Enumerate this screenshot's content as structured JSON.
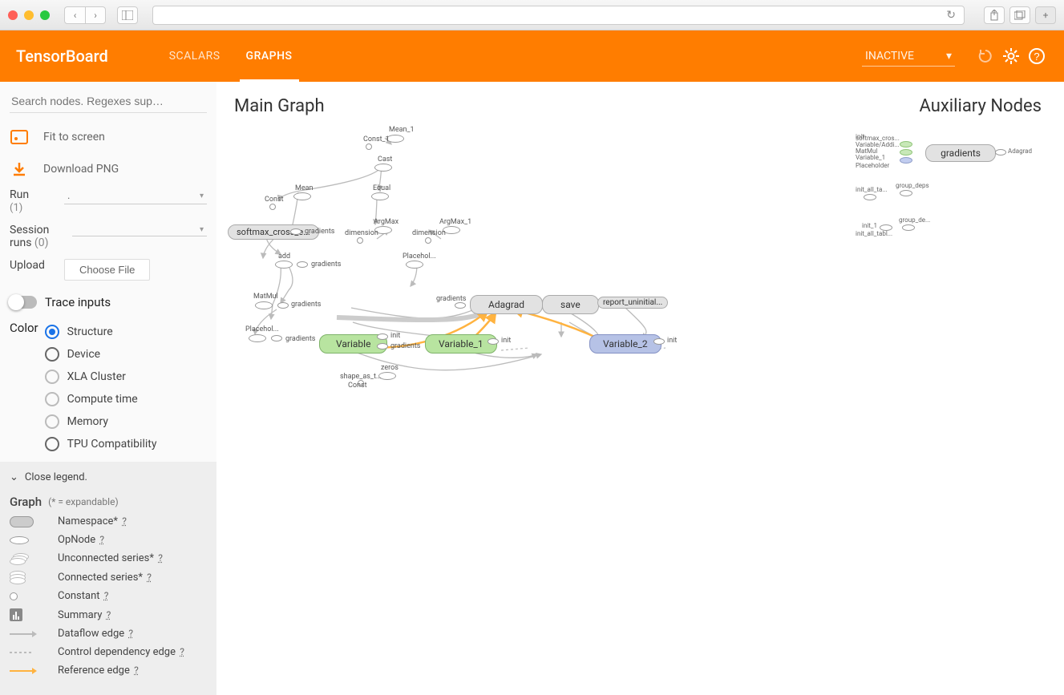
{
  "browser": {
    "reload_icon": "↻"
  },
  "header": {
    "logo": "TensorBoard",
    "tabs": [
      "SCALARS",
      "GRAPHS"
    ],
    "active_tab": 1,
    "dropdown": "INACTIVE"
  },
  "sidebar": {
    "search_placeholder": "Search nodes. Regexes sup…",
    "fit": "Fit to screen",
    "download": "Download PNG",
    "run_label": "Run",
    "run_count": "(1)",
    "run_value": ".",
    "session_label": "Session runs",
    "session_count": "(0)",
    "upload_label": "Upload",
    "choose_file": "Choose File",
    "trace": "Trace inputs",
    "color_label": "Color",
    "color_options": [
      "Structure",
      "Device",
      "XLA Cluster",
      "Compute time",
      "Memory",
      "TPU Compatibility"
    ]
  },
  "legend": {
    "close": "Close legend.",
    "title": "Graph",
    "hint": "(* = expandable)",
    "items": [
      "Namespace*",
      "OpNode",
      "Unconnected series*",
      "Connected series*",
      "Constant",
      "Summary",
      "Dataflow edge",
      "Control dependency edge",
      "Reference edge"
    ]
  },
  "canvas": {
    "main_title": "Main Graph",
    "aux_title": "Auxiliary Nodes",
    "nodes": {
      "softmax": "softmax_cross_e...",
      "adagrad": "Adagrad",
      "save": "save",
      "report": "report_uninitial...",
      "variable": "Variable",
      "variable1": "Variable_1",
      "variable2": "Variable_2",
      "gradients": "gradients",
      "mean1": "Mean_1",
      "const1": "Const_1",
      "cast": "Cast",
      "mean": "Mean",
      "const": "Const",
      "equal": "Equal",
      "argmax": "ArgMax",
      "argmax1": "ArgMax_1",
      "dimension": "dimension",
      "add": "add",
      "matmul": "MatMul",
      "placehol": "Placehol...",
      "zeros": "zeros",
      "shape_as": "shape_as_t...",
      "init": "init",
      "group_deps": "group_deps",
      "group_de": "group_de...",
      "init1": "init_1",
      "init_all_ta": "init_all_ta...",
      "init_all_tabl": "init_all_tabl...",
      "adagrad_s": "Adagrad",
      "softmax_label": "softmax_cros...",
      "variable_label": "Variable_1",
      "matmul_label": "MatMul",
      "varadd_label": "Variable/Addi...",
      "placeholder_label": "Placeholder"
    }
  }
}
